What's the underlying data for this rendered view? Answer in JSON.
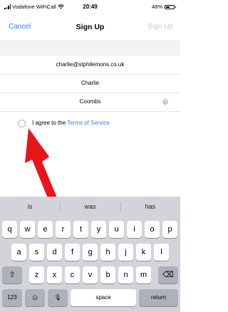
{
  "status_bar": {
    "carrier": "Vodafone WiFiCall",
    "time": "20:49",
    "battery": "48%"
  },
  "nav": {
    "cancel_label": "Cancel",
    "title": "Sign Up",
    "signup_label": "Sign Up"
  },
  "form": {
    "email": "charlie@stphilemons.co.uk",
    "first_name": "Charlie",
    "last_name": "Coombs",
    "clear_glyph": "×",
    "agree_prefix": "I agree to the ",
    "terms_link": "Terms of Service"
  },
  "keyboard": {
    "suggestions": [
      "is",
      "was",
      "has"
    ],
    "row1": [
      "q",
      "w",
      "e",
      "r",
      "t",
      "y",
      "u",
      "i",
      "o",
      "p"
    ],
    "row2": [
      "a",
      "s",
      "d",
      "f",
      "g",
      "h",
      "j",
      "k",
      "l"
    ],
    "row3": [
      "z",
      "x",
      "c",
      "v",
      "b",
      "n",
      "m"
    ],
    "shift_glyph": "⇧",
    "delete_glyph": "⌫",
    "numbers_label": "123",
    "emoji_glyph": "☺",
    "mic_glyph": "🎙",
    "space_label": "space",
    "return_label": "return"
  },
  "colors": {
    "accent": "#2f7cf6",
    "annotation_arrow": "#e8161b",
    "keyboard_bg": "#d2d4da"
  }
}
